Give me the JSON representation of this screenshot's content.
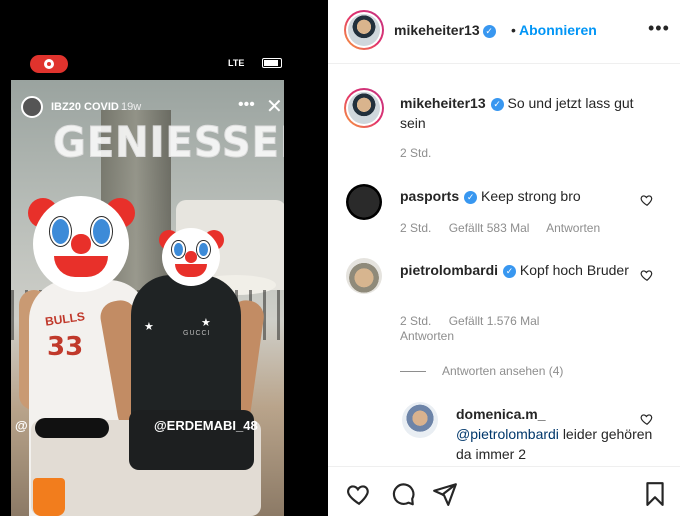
{
  "story": {
    "user": "IBZ20 COVID",
    "time": "19w",
    "overlay_text": "GENIESSER",
    "carrier": "LTE",
    "jersey_team": "BULLS",
    "jersey_number": "33",
    "shirt_brand": "GUCCI",
    "mention_left": "@",
    "mention_right": "@ERDEMABI_48"
  },
  "post": {
    "author": "mikeheiter13",
    "follow_label": "Abonnieren",
    "separator": "•",
    "more_label": "•••",
    "caption": "So und jetzt lass gut sein",
    "caption_time": "2 Std."
  },
  "comments": [
    {
      "user": "pasports",
      "verified": true,
      "text": "Keep strong bro",
      "time": "2 Std.",
      "likes": "Gefällt 583 Mal",
      "reply_label": "Antworten"
    },
    {
      "user": "pietrolombardi",
      "verified": true,
      "text": "Kopf hoch Bruder",
      "time": "2 Std.",
      "likes": "Gefällt 1.576 Mal",
      "reply_label": "Antworten",
      "view_replies": "Antworten ansehen (4)",
      "replies": [
        {
          "user": "domenica.m_",
          "mention": "@pietrolombardi",
          "text": "leider gehören da immer 2"
        }
      ]
    }
  ],
  "actions": {
    "like": "heart-icon",
    "comment": "comment-icon",
    "share": "share-icon",
    "save": "bookmark-icon"
  },
  "colors": {
    "accent": "#0095f6",
    "verified": "#3897f0",
    "meta_text": "#8e8e8e"
  }
}
